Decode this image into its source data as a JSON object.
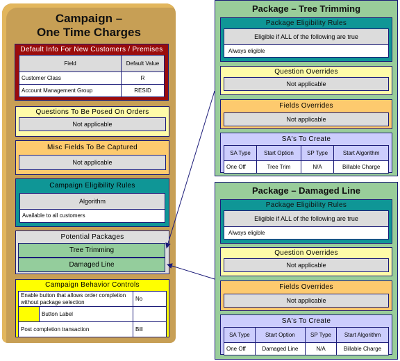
{
  "campaign": {
    "title_line1": "Campaign –",
    "title_line2": "One Time Charges",
    "default_info": {
      "header": "Default Info For New Customers / Premises",
      "columns": [
        "Field",
        "Default Value"
      ],
      "rows": [
        {
          "field": "Customer Class",
          "value": "R"
        },
        {
          "field": "Account Management Group",
          "value": "RESID"
        }
      ]
    },
    "questions": {
      "header": "Questions To Be Posed On Orders",
      "value": "Not applicable"
    },
    "misc_fields": {
      "header": "Misc Fields To Be Captured",
      "value": "Not applicable"
    },
    "eligibility": {
      "header": "Campaign Eligibility Rules",
      "column": "Algorithm",
      "value": "Available to all customers"
    },
    "potential_packages": {
      "header": "Potential Packages",
      "items": [
        "Tree Trimming",
        "Damaged Line"
      ]
    },
    "behavior": {
      "header": "Campaign Behavior Controls",
      "rows": [
        {
          "label": "Enable button that allows order completion without package selection",
          "value": "No"
        },
        {
          "label": "Button Label",
          "value": ""
        },
        {
          "label": "Post completion transaction",
          "value": "Bill"
        }
      ]
    }
  },
  "packages": [
    {
      "title": "Package – Tree Trimming",
      "eligibility_header": "Package Eligibility Rules",
      "eligibility_condition": "Eligible if ALL of the following are true",
      "eligibility_value": "Always eligible",
      "question_overrides_header": "Question Overrides",
      "question_overrides_value": "Not applicable",
      "field_overrides_header": "Fields Overrides",
      "field_overrides_value": "Not applicable",
      "sa_header": "SA's To Create",
      "sa_columns": [
        "SA Type",
        "Start Option",
        "SP Type",
        "Start Algorithm"
      ],
      "sa_row": [
        "One Off",
        "Tree Trim",
        "N/A",
        "Billable Charge"
      ]
    },
    {
      "title": "Package – Damaged Line",
      "eligibility_header": "Package Eligibility Rules",
      "eligibility_condition": "Eligible if ALL of the following are true",
      "eligibility_value": "Always eligible",
      "question_overrides_header": "Question Overrides",
      "question_overrides_value": "Not applicable",
      "field_overrides_header": "Fields Overrides",
      "field_overrides_value": "Not applicable",
      "sa_header": "SA's To Create",
      "sa_columns": [
        "SA Type",
        "Start Option",
        "SP Type",
        "Start Algorithm"
      ],
      "sa_row": [
        "One Off",
        "Damaged Line",
        "N/A",
        "Billable Charge"
      ]
    }
  ],
  "colors": {
    "campaign_bg": "#c79f55",
    "package_bg": "#99cd9a",
    "default_info_bg": "#9b0c0c",
    "eligibility_bg": "#0f9696",
    "questions_bg": "#fefba8",
    "fields_bg": "#fdca6e",
    "behavior_bg": "#ffff00",
    "sa_bg": "#cccdfd",
    "border": "#1b1b78"
  }
}
